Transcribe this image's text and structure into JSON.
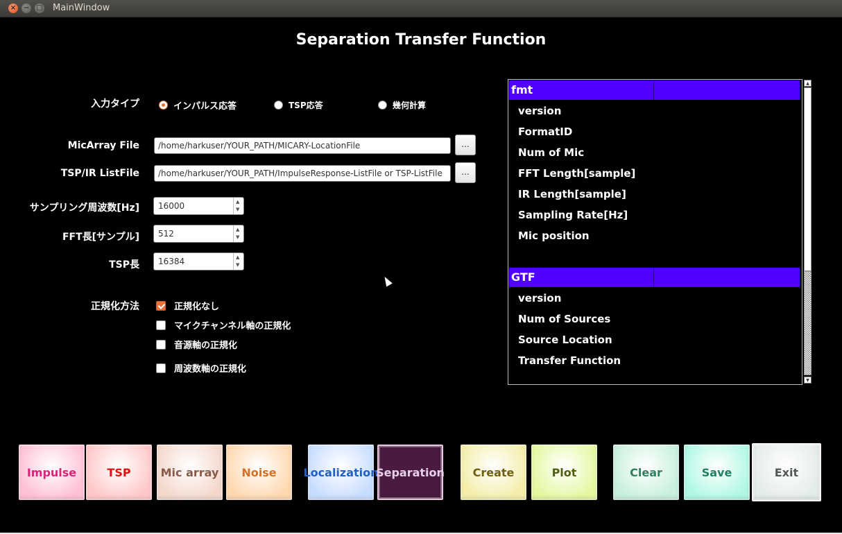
{
  "window": {
    "title": "MainWindow"
  },
  "heading": "Separation Transfer Function",
  "input_type": {
    "label": "入力タイプ",
    "options": [
      {
        "label": "インパルス応答",
        "selected": true
      },
      {
        "label": "TSP応答",
        "selected": false
      },
      {
        "label": "幾何計算",
        "selected": false
      }
    ]
  },
  "files": {
    "micarray": {
      "label": "MicArray File",
      "value": "/home/harkuser/YOUR_PATH/MICARY-LocationFile",
      "browse": "..."
    },
    "tsp_list": {
      "label": "TSP/IR ListFile",
      "value": "/home/harkuser/YOUR_PATH/ImpulseResponse-ListFile or TSP-ListFile",
      "browse": "..."
    }
  },
  "params": {
    "sampling": {
      "label": "サンプリング周波数[Hz]",
      "value": "16000"
    },
    "fft": {
      "label": "FFT長[サンプル]",
      "value": "512"
    },
    "tsp": {
      "label": "TSP長",
      "value": "16384"
    }
  },
  "normalize": {
    "label": "正規化方法",
    "options": [
      {
        "label": "正規化なし",
        "checked": true
      },
      {
        "label": "マイクチャンネル軸の正規化",
        "checked": false
      },
      {
        "label": "音源軸の正規化",
        "checked": false
      },
      {
        "label": "周波数軸の正規化",
        "checked": false
      }
    ]
  },
  "tree": {
    "sections": [
      {
        "header": "fmt",
        "items": [
          "version",
          "FormatID",
          "Num of Mic",
          "FFT Length[sample]",
          "IR Length[sample]",
          "Sampling Rate[Hz]",
          "Mic position"
        ]
      },
      {
        "header": "GTF",
        "items": [
          "version",
          "Num of Sources",
          "Source Location",
          "Transfer Function"
        ]
      }
    ]
  },
  "bottom_buttons": [
    {
      "label": "Impulse",
      "bg": "#ffc0d6",
      "fg": "#e0207a"
    },
    {
      "label": "TSP",
      "bg": "#ffc8c8",
      "fg": "#e01010"
    },
    {
      "label": "Mic array",
      "bg": "#f4d8cc",
      "fg": "#8a5a48"
    },
    {
      "label": "Noise",
      "bg": "#ffd8b0",
      "fg": "#d87020"
    },
    {
      "label": "Localization",
      "bg": "#c8ddff",
      "fg": "#2060c8"
    },
    {
      "label": "Separation",
      "bg": "#4a1a40",
      "fg": "#e8d0e8"
    },
    {
      "label": "Create",
      "bg": "#f4eeaa",
      "fg": "#706010"
    },
    {
      "label": "Plot",
      "bg": "#e4f8a0",
      "fg": "#506010"
    },
    {
      "label": "Clear",
      "bg": "#c8f0dc",
      "fg": "#308060"
    },
    {
      "label": "Save",
      "bg": "#b0f8e4",
      "fg": "#208060"
    },
    {
      "label": "Exit",
      "bg": "#e4ece8",
      "fg": "#505858"
    }
  ]
}
